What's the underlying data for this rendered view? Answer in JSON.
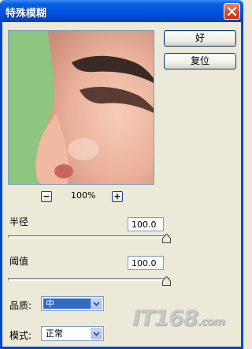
{
  "window": {
    "title": "特殊模糊"
  },
  "preview": {
    "zoom_level": "100%",
    "zoom_out_label": "−",
    "zoom_in_label": "+"
  },
  "buttons": {
    "ok_label": "好",
    "reset_label": "复位"
  },
  "radius": {
    "label": "半径",
    "value": "100.0",
    "level": 1.0
  },
  "threshold": {
    "label": "阈值",
    "value": "100.0",
    "level": 1.0
  },
  "quality": {
    "label": "品质:",
    "value": "中"
  },
  "mode": {
    "label": "模式:",
    "value": "正常"
  },
  "watermark": {
    "text": "IT168",
    "suffix": ".com"
  },
  "colors": {
    "title_bar": "#0054e3",
    "dialog_bg": "#ece9d8",
    "selection": "#316ac5",
    "close_button": "#d5461e"
  }
}
